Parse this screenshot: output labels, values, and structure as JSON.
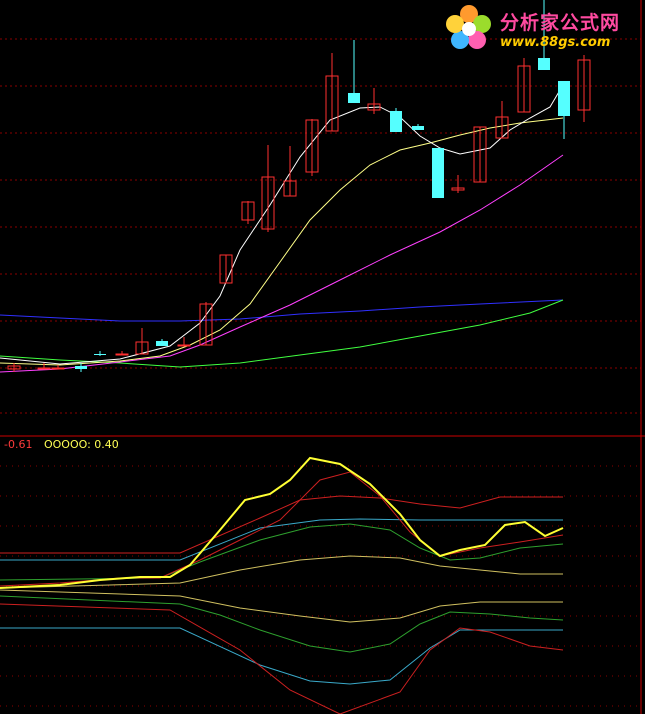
{
  "watermark": {
    "site_name": "分析家公式网",
    "site_url": "www.88gs.com"
  },
  "readout": {
    "first_value": "-0.61",
    "second_label": "OOOOO:",
    "second_value": "0.40"
  },
  "colors": {
    "background": "#000000",
    "grid": "#8a0000",
    "divider": "#cc0000",
    "up_candle": "#ff3030",
    "down_candle": "#55ffff",
    "ma_white": "#ffffff",
    "ma_yellow": "#ffff88",
    "ma_magenta": "#ff40ff",
    "ma_green": "#40ff40",
    "ma_blue": "#3030ff"
  },
  "chart_data": [
    {
      "type": "candlestick",
      "series": [
        {
          "name": "price",
          "values": [
            {
              "o": 369.0,
              "h": 372.0,
              "l": 363.0,
              "c": 366.0
            },
            {
              "o": 368.0,
              "h": 369.0,
              "l": 363.0,
              "c": 368.0
            },
            {
              "o": 368.0,
              "h": 369.0,
              "l": 365.0,
              "c": 368.0
            },
            {
              "o": 366.0,
              "h": 372.0,
              "l": 363.0,
              "c": 369.0
            },
            {
              "o": 354.0,
              "h": 351.0,
              "l": 356.0,
              "c": 355.0
            },
            {
              "o": 354.0,
              "h": 355.0,
              "l": 351.0,
              "c": 354.0
            },
            {
              "o": 354.0,
              "h": 328.0,
              "l": 354.0,
              "c": 342.0
            },
            {
              "o": 341.0,
              "h": 339.0,
              "l": 346.0,
              "c": 346.0
            },
            {
              "o": 346.0,
              "h": 337.0,
              "l": 346.0,
              "c": 345.0
            },
            {
              "o": 345.0,
              "h": 302.0,
              "l": 345.0,
              "c": 304.0
            },
            {
              "o": 283.0,
              "h": 255.0,
              "l": 283.0,
              "c": 255.0
            },
            {
              "o": 220.0,
              "h": 201.0,
              "l": 224.0,
              "c": 202.0
            },
            {
              "o": 229.0,
              "h": 145.0,
              "l": 232.0,
              "c": 177.0
            },
            {
              "o": 196.0,
              "h": 146.0,
              "l": 196.0,
              "c": 181.0
            },
            {
              "o": 172.0,
              "h": 119.0,
              "l": 176.0,
              "c": 120.0
            },
            {
              "o": 131.0,
              "h": 53.0,
              "l": 131.0,
              "c": 76.0
            },
            {
              "o": 93.0,
              "h": 40.0,
              "l": 103.0,
              "c": 103.0
            },
            {
              "o": 110.0,
              "h": 88.0,
              "l": 114.0,
              "c": 104.0
            },
            {
              "o": 111.0,
              "h": 108.0,
              "l": 132.0,
              "c": 132.0
            },
            {
              "o": 126.0,
              "h": 124.0,
              "l": 130.0,
              "c": 130.0
            },
            {
              "o": 148.0,
              "h": 148.0,
              "l": 198.0,
              "c": 198.0
            },
            {
              "o": 190.0,
              "h": 175.0,
              "l": 193.0,
              "c": 188.0
            },
            {
              "o": 182.0,
              "h": 127.0,
              "l": 182.0,
              "c": 127.0
            },
            {
              "o": 138.0,
              "h": 101.0,
              "l": 138.0,
              "c": 117.0
            },
            {
              "o": 112.0,
              "h": 58.0,
              "l": 112.0,
              "c": 66.0
            },
            {
              "o": 58.0,
              "h": 0.0,
              "l": 70.0,
              "c": 70.0
            },
            {
              "o": 81.0,
              "h": 81.0,
              "l": 139.0,
              "c": 116.0
            },
            {
              "o": 110.0,
              "h": 55.0,
              "l": 122.0,
              "c": 60.0
            }
          ]
        }
      ]
    },
    {
      "type": "line",
      "title": "",
      "series": [],
      "readout": [
        "-0.61",
        "0.40"
      ]
    }
  ]
}
